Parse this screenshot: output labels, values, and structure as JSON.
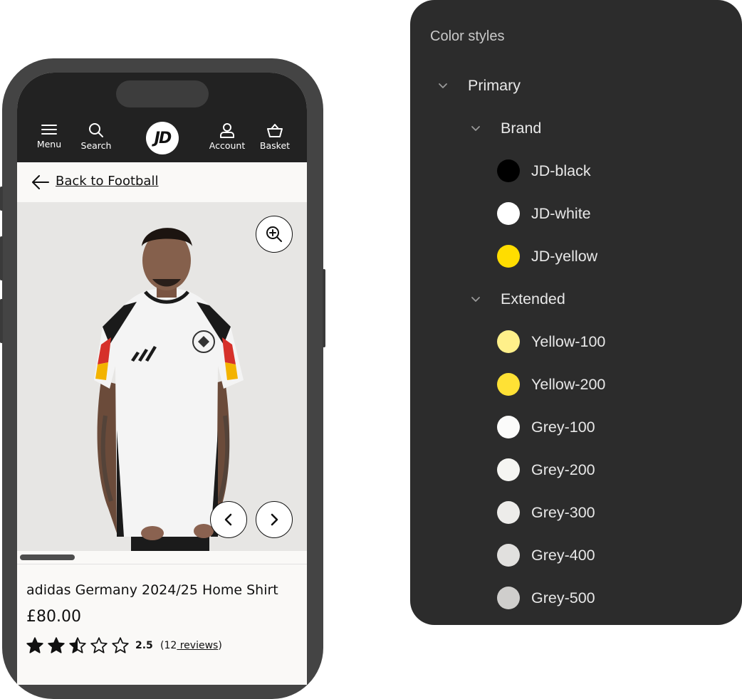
{
  "nav": {
    "menu_label": "Menu",
    "search_label": "Search",
    "logo_text": "JD",
    "account_label": "Account",
    "basket_label": "Basket"
  },
  "back_link": "Back to Football",
  "product": {
    "name": "adidas Germany 2024/25 Home Shirt",
    "price": "£80.00",
    "rating": "2.5",
    "rating_value": 2.5,
    "rating_max": 5,
    "reviews_open": "(12",
    "reviews_link": " reviews",
    "reviews_close": ")"
  },
  "panel": {
    "title": "Color styles",
    "groups": [
      {
        "label": "Primary",
        "subgroups": [
          {
            "label": "Brand",
            "items": [
              {
                "name": "JD-black",
                "color": "#000000"
              },
              {
                "name": "JD-white",
                "color": "#ffffff"
              },
              {
                "name": "JD-yellow",
                "color": "#ffdd00"
              }
            ]
          },
          {
            "label": "Extended",
            "items": [
              {
                "name": "Yellow-100",
                "color": "#fff08a"
              },
              {
                "name": "Yellow-200",
                "color": "#ffe135"
              },
              {
                "name": "Grey-100",
                "color": "#fbfbfa"
              },
              {
                "name": "Grey-200",
                "color": "#f5f5f2"
              },
              {
                "name": "Grey-300",
                "color": "#edecea"
              },
              {
                "name": "Grey-400",
                "color": "#e1e0de"
              },
              {
                "name": "Grey-500",
                "color": "#cfcecc"
              }
            ]
          }
        ]
      }
    ]
  },
  "colors": {
    "header_bg": "#222222",
    "panel_bg": "#2c2c2c",
    "page_bg": "#faf9f7"
  }
}
